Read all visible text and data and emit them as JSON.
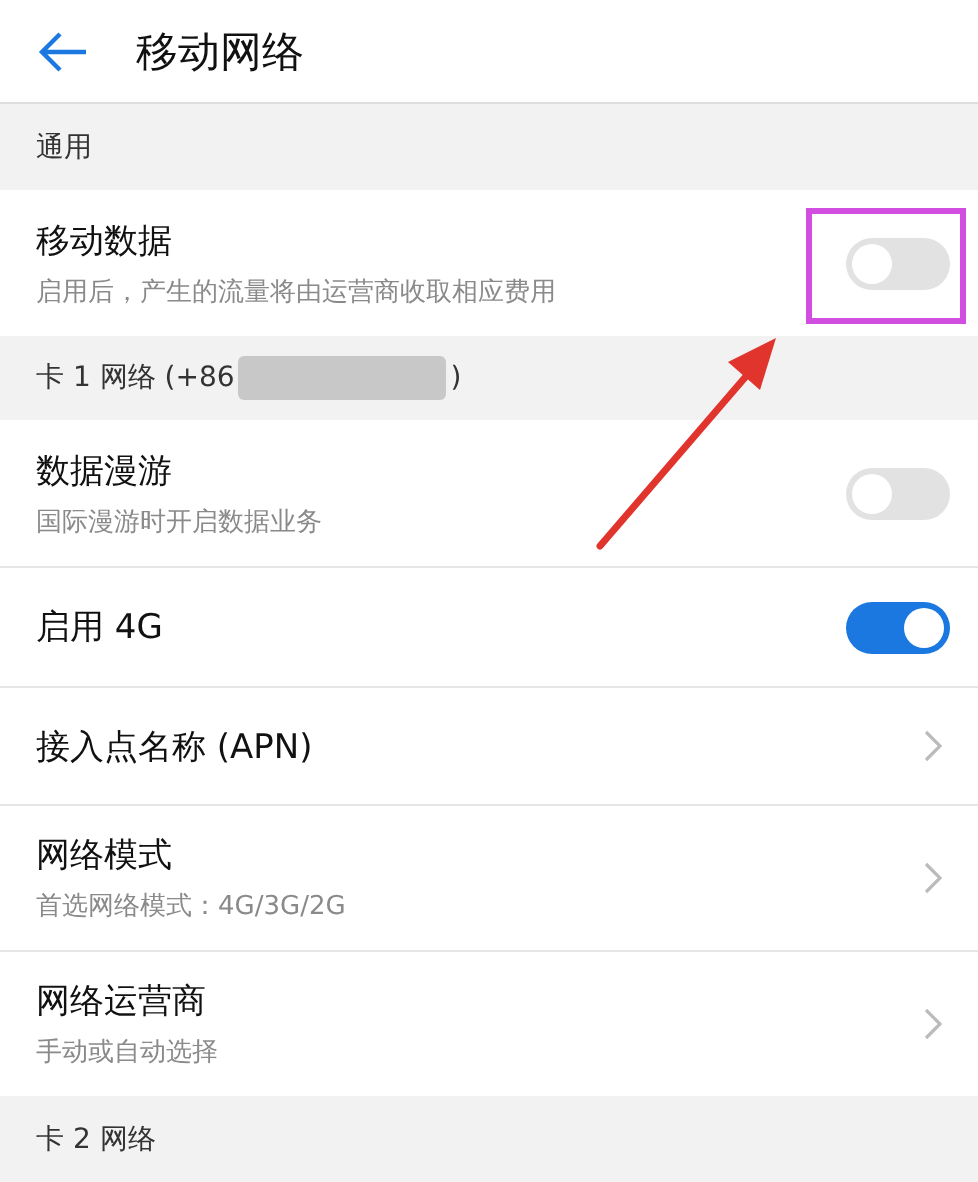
{
  "header": {
    "title": "移动网络"
  },
  "sections": [
    {
      "title": "通用",
      "items": [
        {
          "kind": "toggle",
          "label": "移动数据",
          "sublabel": "启用后，产生的流量将由运营商收取相应费用",
          "on": false,
          "highlighted": true
        }
      ]
    },
    {
      "title": "卡 1 网络 (+86",
      "redacted": true,
      "title_end": ")",
      "items": [
        {
          "kind": "toggle",
          "label": "数据漫游",
          "sublabel": "国际漫游时开启数据业务",
          "on": false
        },
        {
          "kind": "toggle",
          "label": "启用 4G",
          "on": true
        },
        {
          "kind": "link",
          "label": "接入点名称 (APN)"
        },
        {
          "kind": "link",
          "label": "网络模式",
          "sublabel": "首选网络模式：4G/3G/2G"
        },
        {
          "kind": "link",
          "label": "网络运营商",
          "sublabel": "手动或自动选择"
        }
      ]
    },
    {
      "title": "卡 2 网络"
    }
  ],
  "annotations": [
    {
      "kind": "arrow"
    }
  ]
}
